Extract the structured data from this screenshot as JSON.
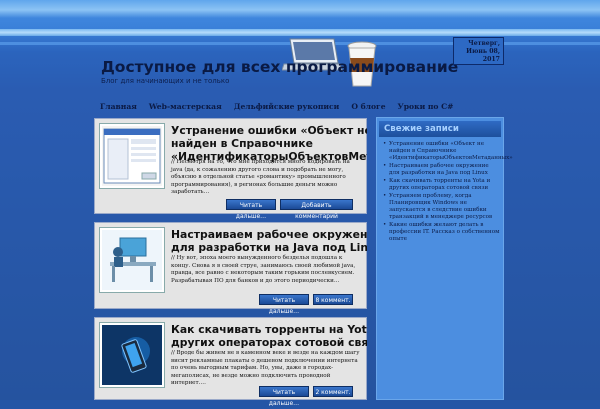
{
  "header": {
    "title": "Доступное для всех программирование",
    "subtitle": "Блог для начинающих и не только",
    "date_lines": [
      "Четверг,",
      "Июнь 08,",
      "2017"
    ]
  },
  "nav": {
    "items": [
      "Главная",
      "Web-мастерская",
      "Дельфийские рукописи",
      "О блоге",
      "Уроки по C#"
    ]
  },
  "posts": [
    {
      "title_lines": [
        "Устранение ошибки «Объект не",
        "найден в Справочнике",
        "«ИдентификаторыОбъектовМетадани"
      ],
      "excerpt": "// Несмотря на то, что мне приходится много кодировать на java (да, к сожалению другого слова и подобрать не могу, объясню в отдельной статье «романтику» промышленного программирования), в регионах большие деньги можно заработать…",
      "buttons": [
        "Читать дальше…",
        "Добавить комментарий"
      ],
      "thumb_icon": "dialog-window-icon"
    },
    {
      "title_lines": [
        "Настраиваем рабочее окружение",
        "для разработки на Java под Linux"
      ],
      "excerpt": "// Ну вот, эпоха моего вынужденного безделья подошла к концу. Снова я в своей струе, занимаюсь своей любимой java, правда, все равно с некоторым таким горьким послевкусием. Разрабатывая ПО для банков и до этого периодически…",
      "buttons": [
        "Читать дальше…",
        "8 коммент."
      ],
      "thumb_icon": "developer-desk-icon"
    },
    {
      "title_lines": [
        "Как скачивать торренты на Yota и",
        "других операторах сотовой связи"
      ],
      "excerpt": "// Вроде бы живем не в каменном веке и везде на каждом шагу висит рекламные плакаты о дешевом подключении интернета по очень выгодным тарифам. Но, увы, даже в городах-мегаполисах, не везде можно подключить проводной интернет.…",
      "buttons": [
        "Читать дальше…",
        "2 коммент."
      ],
      "thumb_icon": "smartphone-icon"
    }
  ],
  "sidebar": {
    "heading": "Свежие записи",
    "items": [
      "Устранение ошибки «Объект не найден в Справочнике «ИдентификаторыОбъектовМетаданных»",
      "Настраиваем рабочее окружение для разработки на Java под Linux",
      "Как скачивать торренты на Yota и других операторах сотовой связи",
      "Устраняем проблему, когда Планировщик Windows не запускается в следствие ошибки транзакций в менеджере ресурсов",
      "Какие ошибки желают делать в профессии IT. Рассказ о собственном опыте"
    ]
  },
  "colors": {
    "accent": "#2456a6",
    "button": "#1b4a96",
    "sidebar": "#4c8ee0"
  }
}
